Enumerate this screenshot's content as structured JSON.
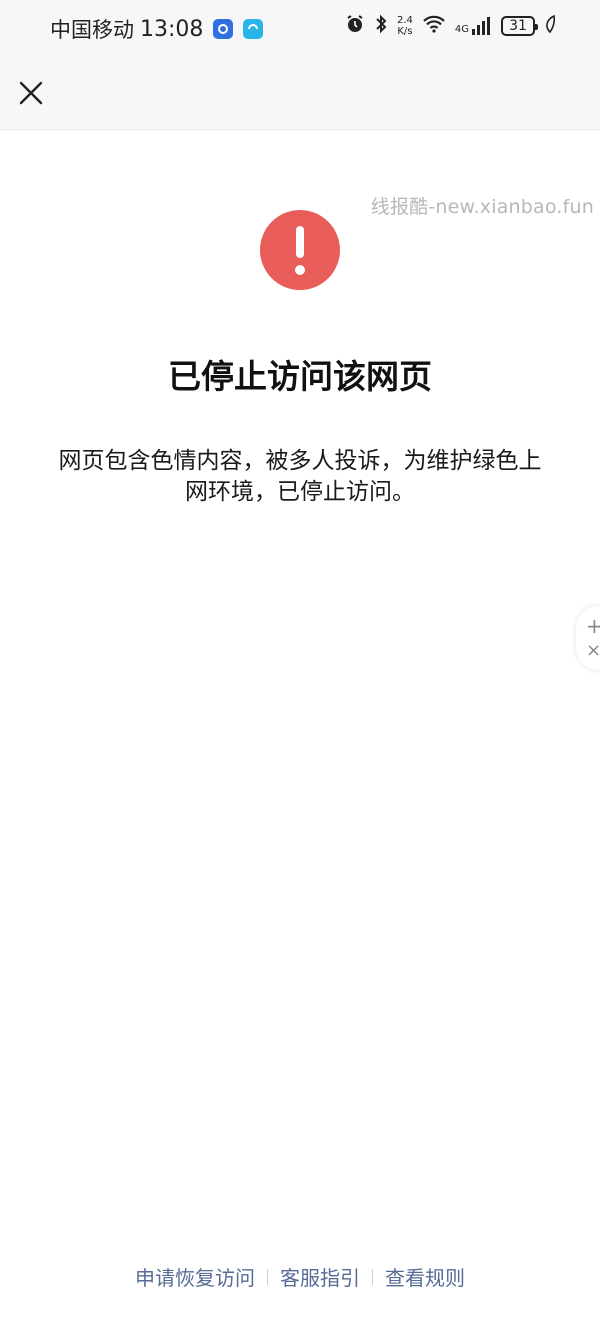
{
  "status_bar": {
    "carrier": "中国移动",
    "time": "13:08",
    "net_speed_value": "2.4",
    "net_speed_unit": "K/s",
    "signal_type": "4G",
    "battery_level": "31"
  },
  "nav": {
    "close_icon": "close-icon"
  },
  "watermark": "线报酷-new.xianbao.fun",
  "warning": {
    "icon": "exclamation-icon",
    "color": "#e85d5a",
    "mark": "!"
  },
  "title": "已停止访问该网页",
  "description": "网页包含色情内容，被多人投诉，为维护绿色上网环境，已停止访问。",
  "footer": {
    "links": [
      "申请恢复访问",
      "客服指引",
      "查看规则"
    ],
    "link_color": "#576b95"
  },
  "side_widget": {
    "plus": "+",
    "close": "×"
  }
}
